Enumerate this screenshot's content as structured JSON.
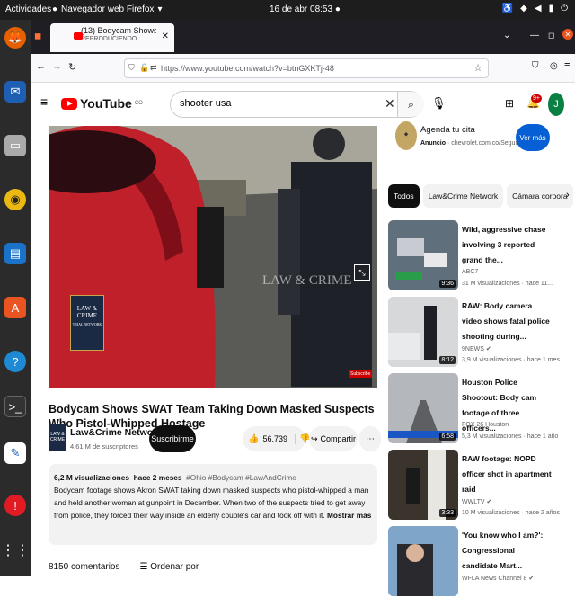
{
  "system": {
    "activities": "Actividades",
    "app_name": "Navegador web Firefox",
    "clock": "16 de abr  08:53"
  },
  "browser": {
    "tab_title": "(13) Bodycam Shows SW",
    "tab_subtitle": "REPRODUCIENDO",
    "url": "https://www.youtube.com/watch?v=btnGXKTj-48",
    "url_host": "www.youtube.com"
  },
  "youtube": {
    "logo": "YouTube",
    "country": "CO",
    "search_value": "shooter usa",
    "notification_count": "9+",
    "avatar_letter": "J"
  },
  "video": {
    "title": "Bodycam Shows SWAT Team Taking Down Masked Suspects Who Pistol-Whipped Hostage",
    "watermark": "LAW & CRIME",
    "logo_text": "LAW & CRIME",
    "logo_sub": "TRIAL NETWORK",
    "channel": "Law&Crime Network",
    "subscribers": "4,61 M de suscriptores",
    "subscribe_label": "Suscribirme",
    "likes": "56.739",
    "share_label": "Compartir",
    "views": "6,2 M visualizaciones",
    "age": "hace 2 meses",
    "hashtags": "#Ohio #Bodycam #LawAndCrime",
    "description": "Bodycam footage shows Akron SWAT taking down masked suspects who pistol-whipped a man and held another woman at gunpoint in December. When two of the suspects tried to get away from police, they forced their way inside an elderly couple's car and took off with it.",
    "show_more": "Mostrar más",
    "comment_count": "8150 comentarios",
    "sort_label": "Ordenar por",
    "subscribe_badge": "Subscribe"
  },
  "ad": {
    "title": "Agenda tu cita",
    "label": "Anuncio",
    "domain": "chevrolet.com.co/Seguridad/",
    "button": "Ver más"
  },
  "chips": [
    "Todos",
    "Law&Crime Network",
    "Cámara corpora"
  ],
  "recommendations": [
    {
      "title": "Wild, aggressive chase involving 3 reported grand the...",
      "channel": "ABC7",
      "views": "31 M visualizaciones · hace 11...",
      "duration": "9:36"
    },
    {
      "title": "RAW: Body camera video shows fatal police shooting during...",
      "channel": "9NEWS",
      "views": "3,9 M visualizaciones · hace 1 mes",
      "duration": "8:12"
    },
    {
      "title": "Houston Police Shootout: Body cam footage of three officers...",
      "channel": "FOX 26 Houston",
      "views": "5,3 M visualizaciones · hace 1 año",
      "duration": "6:58"
    },
    {
      "title": "RAW footage: NOPD officer shot in apartment raid",
      "channel": "WWLTV",
      "views": "10 M visualizaciones · hace 2 años",
      "duration": "3:33"
    },
    {
      "title": "'You know who I am?': Congressional candidate Mart...",
      "channel": "WFLA News Channel 8",
      "views": "",
      "duration": ""
    }
  ]
}
